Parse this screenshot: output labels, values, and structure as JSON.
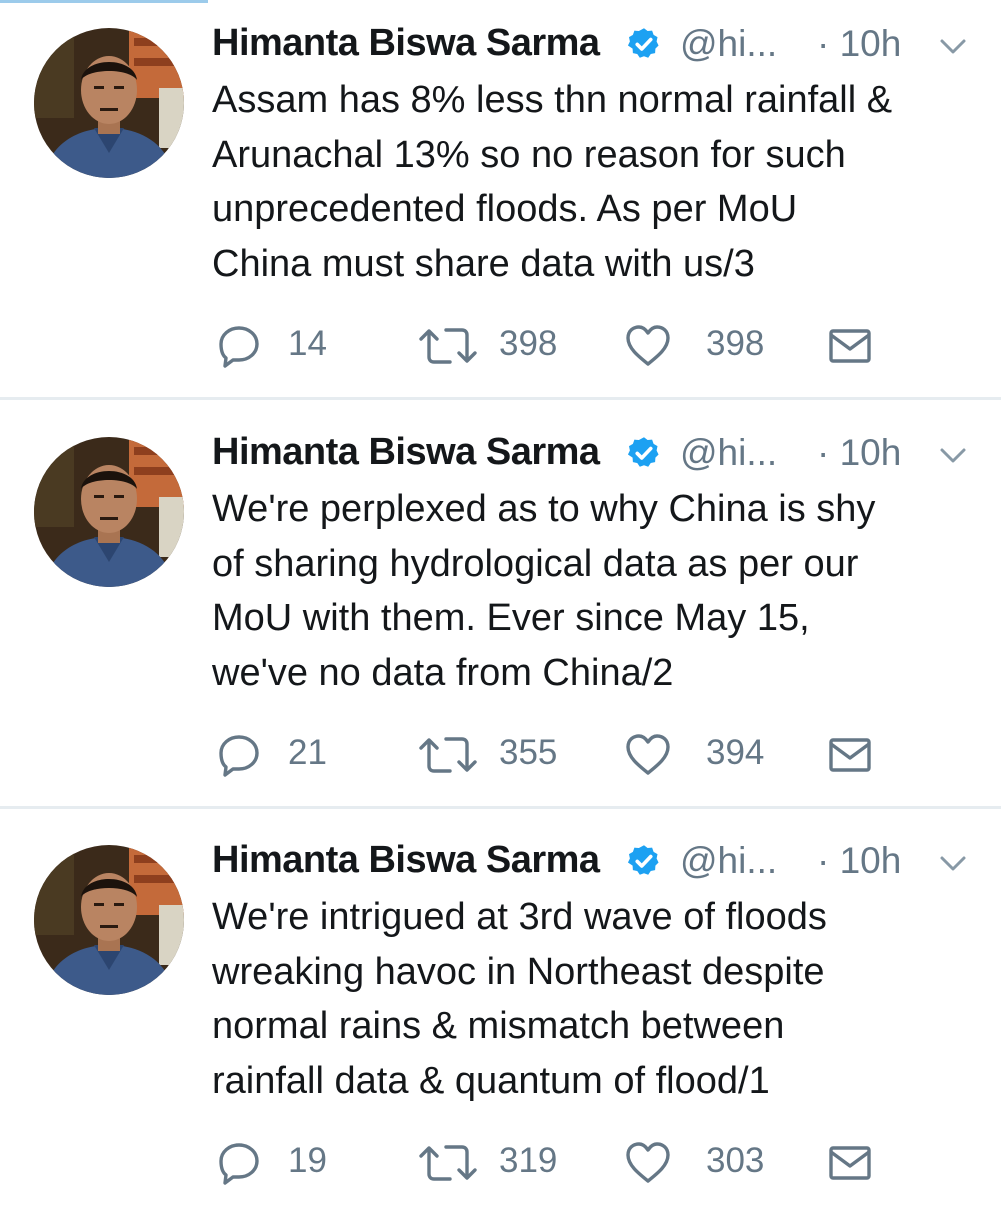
{
  "colors": {
    "text": "#14171a",
    "secondary": "#657786",
    "verified": "#1da1f2",
    "divider": "#e6ecf0"
  },
  "icons": {
    "reply": "reply-icon",
    "retweet": "retweet-icon",
    "like": "like-icon",
    "direct_message": "direct-message-icon",
    "verified": "verified-badge-icon",
    "more": "chevron-down-icon"
  },
  "tweets": [
    {
      "author": {
        "name": "Himanta Biswa Sarma",
        "handle": "@hi..."
      },
      "timestamp": "· 10h",
      "lines": [
        "Assam has 8% less thn normal rainfall &",
        "Arunachal 13% so no reason for such",
        "unprecedented floods. As per MoU",
        "China must share data with us/3"
      ],
      "stats": {
        "replies": "14",
        "retweets": "398",
        "likes": "398"
      }
    },
    {
      "author": {
        "name": "Himanta Biswa Sarma",
        "handle": "@hi..."
      },
      "timestamp": "· 10h",
      "lines": [
        "We're perplexed as to why China is shy",
        "of sharing hydrological data as per our",
        "MoU with them. Ever since May 15,",
        "we've no data from China/2"
      ],
      "stats": {
        "replies": "21",
        "retweets": "355",
        "likes": "394"
      }
    },
    {
      "author": {
        "name": "Himanta Biswa Sarma",
        "handle": "@hi..."
      },
      "timestamp": "· 10h",
      "lines": [
        "We're intrigued at 3rd wave of floods",
        "wreaking havoc in Northeast despite",
        "normal rains & mismatch between",
        "rainfall data & quantum of flood/1"
      ],
      "stats": {
        "replies": "19",
        "retweets": "319",
        "likes": "303"
      }
    }
  ]
}
